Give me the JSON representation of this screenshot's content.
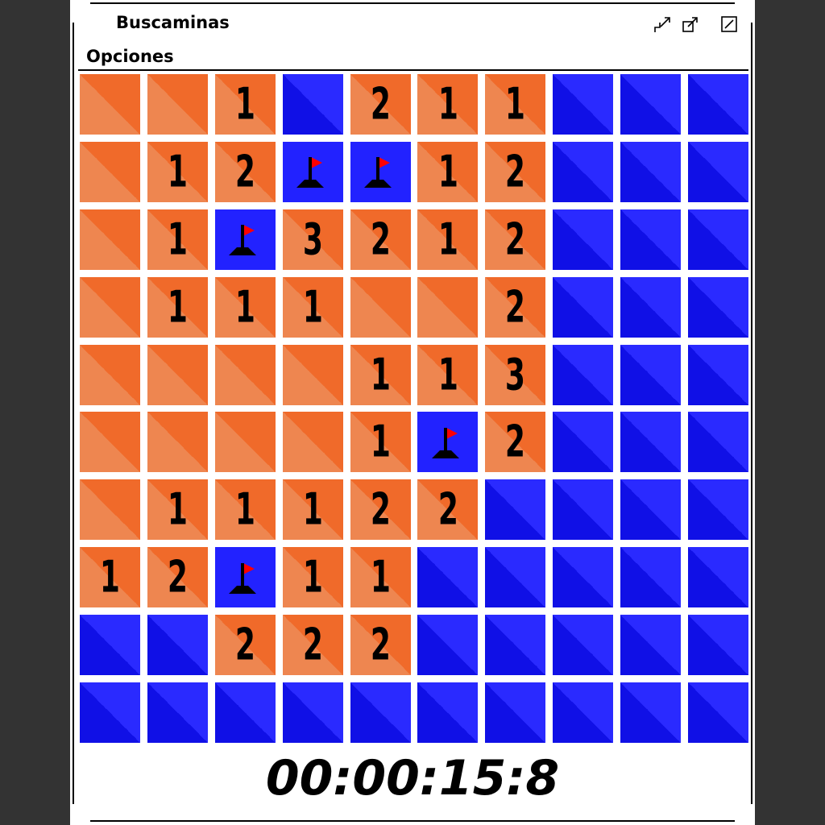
{
  "window": {
    "title": "Buscaminas",
    "controls": [
      {
        "name": "minimize-button",
        "icon": "minimize-icon"
      },
      {
        "name": "restore-button",
        "icon": "restore-icon"
      },
      {
        "name": "maximize-button",
        "icon": "maximize-icon"
      }
    ]
  },
  "menu": {
    "options_label": "Opciones"
  },
  "colors": {
    "revealed": "#f06a2a",
    "hidden": "#2a2aff",
    "flag": "#ff0000",
    "number": "#000000"
  },
  "board": {
    "rows": 10,
    "cols": 10,
    "cells": [
      [
        "",
        "",
        "1",
        "C",
        "2",
        "1",
        "1",
        "C",
        "C",
        "C"
      ],
      [
        "",
        "1",
        "2",
        "F",
        "F",
        "1",
        "2",
        "C",
        "C",
        "C"
      ],
      [
        "",
        "1",
        "F",
        "3",
        "2",
        "1",
        "2",
        "C",
        "C",
        "C"
      ],
      [
        "",
        "1",
        "1",
        "1",
        "",
        "",
        "2",
        "C",
        "C",
        "C"
      ],
      [
        "",
        "",
        "",
        "",
        "1",
        "1",
        "3",
        "C",
        "C",
        "C"
      ],
      [
        "",
        "",
        "",
        "",
        "1",
        "F",
        "2",
        "C",
        "C",
        "C"
      ],
      [
        "",
        "1",
        "1",
        "1",
        "2",
        "2",
        "C",
        "C",
        "C",
        "C"
      ],
      [
        "1",
        "2",
        "F",
        "1",
        "1",
        "C",
        "C",
        "C",
        "C",
        "C"
      ],
      [
        "C",
        "C",
        "2",
        "2",
        "2",
        "C",
        "C",
        "C",
        "C",
        "C"
      ],
      [
        "C",
        "C",
        "C",
        "C",
        "C",
        "C",
        "C",
        "C",
        "C",
        "C"
      ]
    ],
    "legend": {
      "C": "hidden-cell",
      "F": "flagged-cell",
      "": "revealed-empty-cell"
    }
  },
  "timer": {
    "value": "00:00:15:8"
  }
}
